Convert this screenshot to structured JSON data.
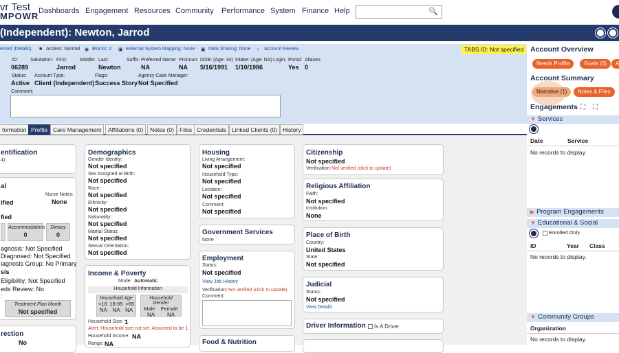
{
  "app": {
    "logo_line1": "vr Test",
    "logo_line2": "MPOWR"
  },
  "nav": [
    "Dashboards",
    "Engagement",
    "Resources",
    "Community",
    "Performance",
    "System",
    "Finance",
    "Help"
  ],
  "header": {
    "title": "(Independent): Newton, Jarrod"
  },
  "statusbar": {
    "items": [
      "ented (Details)",
      "Access: Normal",
      "Blocks: 0",
      "External System Mapping: None",
      "Data Sharing: None",
      "Account Review"
    ],
    "tabs_id": "TABS ID: Not specified"
  },
  "demo": {
    "id_label": "ID:",
    "id": "06289",
    "salutation_label": "Salutation:",
    "first_label": "First:",
    "first": "Jarrod",
    "middle_label": "Middle:",
    "last_label": "Last:",
    "last": "Newton",
    "suffix_label": "Suffix:",
    "preferred_label": "Preferred Name:",
    "preferred": "NA",
    "pronoun_label": "Pronoun:",
    "pronoun": "NA",
    "dob_label": "DOB: (Age: 34)",
    "dob": "5/16/1991",
    "intake_label": "Intake: (Age: NA)",
    "intake": "1/10/1986",
    "login_label": "Login:",
    "portal_label": "Portal:",
    "portal": "Yes",
    "aliases_label": "Aliases:",
    "aliases": "0",
    "status_label": "Status:",
    "status": "Active",
    "account_type_label": "Account Type:",
    "account_type": "Client (Independent)",
    "flags_label": "Flags:",
    "flags": "Success Story",
    "acm_label": "Agency Case Manager:",
    "acm": "Not Specified",
    "comment_label": "Comment:"
  },
  "tabs": [
    "formation",
    "Profile",
    "Care Management",
    "Affiliations (0)",
    "Notes (0)",
    "Files",
    "Credentials",
    "Linked Clients (0)",
    "History"
  ],
  "col1": {
    "ident_title": "entification",
    "ident_sub": "4):",
    "al_title": "al",
    "nurse_label": "Nurse Notes:",
    "nurse": "None",
    "v1": "ified",
    "v2": "fied",
    "accom_label": "Accommodations",
    "accom": "0",
    "dietary_label": "Dietary",
    "dietary": "0",
    "r1": "agnosis: Not Specified",
    "r2": "Diagnosed: Not Specified",
    "r3": "iagnosis Group: No Primary",
    "r4": "sis",
    "r5": "Eligibility: Not Specified",
    "r6": "eds Review: No",
    "r7": ":",
    "tpm_label": "Treatment Plan Month",
    "tpm": "Not specified",
    "r8": "rection",
    "r9": "No"
  },
  "demographics": {
    "title": "Demographics",
    "fields": [
      {
        "label": "Gender Identity:",
        "value": "Not specified"
      },
      {
        "label": "Sex Assigned at Birth:",
        "value": "Not specified"
      },
      {
        "label": "Race:",
        "value": "Not specified"
      },
      {
        "label": "Ethnicity:",
        "value": "Not specified"
      },
      {
        "label": "Nationality:",
        "value": "Not specified"
      },
      {
        "label": "Marital Status:",
        "value": "Not specified"
      },
      {
        "label": "Sexual Orientation:",
        "value": "Not specified"
      }
    ]
  },
  "income": {
    "title": "Income & Poverty",
    "mode_label": "Mode:",
    "mode": "Automatic",
    "hh_info": "Household Information",
    "age_head": "Household Age",
    "ages": [
      "<18",
      "18-65",
      ">65"
    ],
    "age_vals": [
      "NA",
      "NA",
      "NA"
    ],
    "gender_head": "Household Gender",
    "genders": [
      "Male",
      "Female"
    ],
    "gender_vals": [
      "NA",
      "NA"
    ],
    "size_label": "Household Size:",
    "size": "1",
    "alert": "Alert: Household size not set. Assumed to be 1.",
    "income_label": "Household Income:",
    "income": "NA",
    "range_label": "Range:",
    "range": "NA"
  },
  "housing": {
    "title": "Housing",
    "fields": [
      {
        "label": "Living Arrangement:",
        "value": "Not specified"
      },
      {
        "label": "Household Type:",
        "value": "Not specified"
      },
      {
        "label": "Location:",
        "value": "Not specified"
      },
      {
        "label": "Comment:",
        "value": "Not specified"
      }
    ]
  },
  "gov": {
    "title": "Government Services",
    "value": "None"
  },
  "employment": {
    "title": "Employment",
    "status_label": "Status:",
    "status": "Not specified",
    "history_link": "View Job History",
    "verif_label": "Verification:",
    "verif": "Not verified (click to update)",
    "comment_label": "Comment:"
  },
  "food": {
    "title": "Food & Nutrition"
  },
  "citizenship": {
    "title": "Citizenship",
    "value": "Not specified",
    "verif_label": "Verification:",
    "verif": "Not verified (click to update)"
  },
  "religion": {
    "title": "Religious Affiliation",
    "faith_label": "Faith:",
    "faith": "Not specified",
    "inst_label": "Institution:",
    "inst": "None"
  },
  "birth": {
    "title": "Place of Birth",
    "country_label": "Country:",
    "country": "United States",
    "state_label": "State:",
    "state": "Not specified"
  },
  "judicial": {
    "title": "Judicial",
    "status_label": "Status:",
    "status": "Not specified",
    "details_link": "View Details"
  },
  "driver": {
    "title": "Driver Information",
    "checkbox_label": "Is A Driver"
  },
  "right": {
    "overview_title": "Account Overview",
    "needs_profile": "Needs Profile",
    "goals": "Goals (0)",
    "extra": "A",
    "summary_title": "Account Summary",
    "narrative": "Narrative (1)",
    "notes_files": "Notes & Files",
    "engagements_title": "Engagements",
    "services": "Services",
    "date_col": "Date",
    "service_col": "Service",
    "services_empty": "No records to display.",
    "program": "Program Engagements",
    "edu": "Educational & Social",
    "enrolled": "Enrolled Only",
    "id_col": "ID",
    "year_col": "Year",
    "class_col": "Class",
    "edu_empty": "No records to display.",
    "community": "Community Groups",
    "org_col": "Organization",
    "community_empty": "No records to display."
  }
}
